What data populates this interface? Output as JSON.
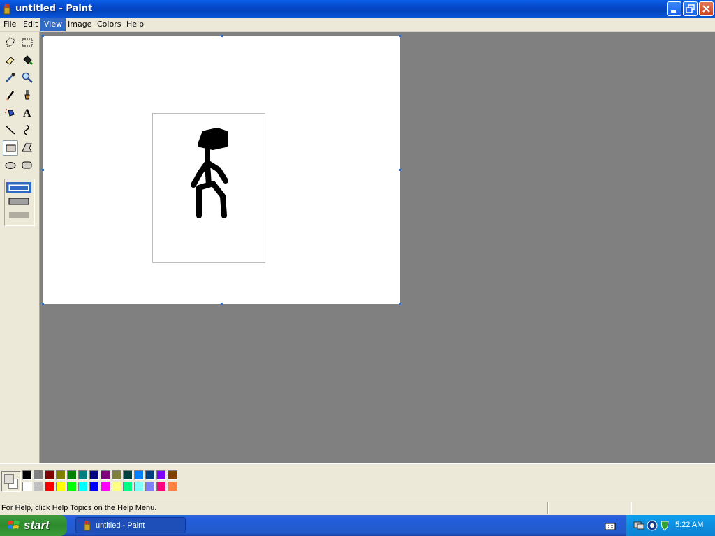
{
  "window": {
    "title": "untitled - Paint",
    "accent_color": "#0a55dc",
    "controls": [
      "minimize-icon",
      "restore-icon",
      "close-icon"
    ]
  },
  "menu": {
    "items": [
      "File",
      "Edit",
      "View",
      "Image",
      "Colors",
      "Help"
    ],
    "active": "View"
  },
  "toolbox": {
    "tools": [
      "free-form-select",
      "rect-select",
      "eraser",
      "fill",
      "pick-color",
      "magnifier",
      "pencil",
      "brush",
      "airbrush",
      "text",
      "line",
      "curve",
      "rectangle",
      "polygon",
      "ellipse",
      "rounded-rectangle"
    ],
    "selected": "rectangle",
    "fill_options": [
      "outline",
      "outline-and-fill",
      "fill"
    ]
  },
  "palette": {
    "foreground": "#000000",
    "background": "#ffffff",
    "top_row": [
      "#000000",
      "#808080",
      "#800000",
      "#808000",
      "#008000",
      "#008080",
      "#000080",
      "#800080",
      "#808040",
      "#004040",
      "#0080ff",
      "#004080",
      "#8000ff",
      "#804000"
    ],
    "bottom_row": [
      "#ffffff",
      "#c0c0c0",
      "#ff0000",
      "#ffff00",
      "#00ff00",
      "#00ffff",
      "#0000ff",
      "#ff00ff",
      "#ffff80",
      "#00ff80",
      "#80ffff",
      "#8080ff",
      "#ff0080",
      "#ff8040"
    ]
  },
  "status": {
    "help_text": "For Help, click Help Topics on the Help Menu."
  },
  "taskbar": {
    "start_label": "start",
    "task_label": "untitled - Paint",
    "clock": "5:22 AM"
  }
}
